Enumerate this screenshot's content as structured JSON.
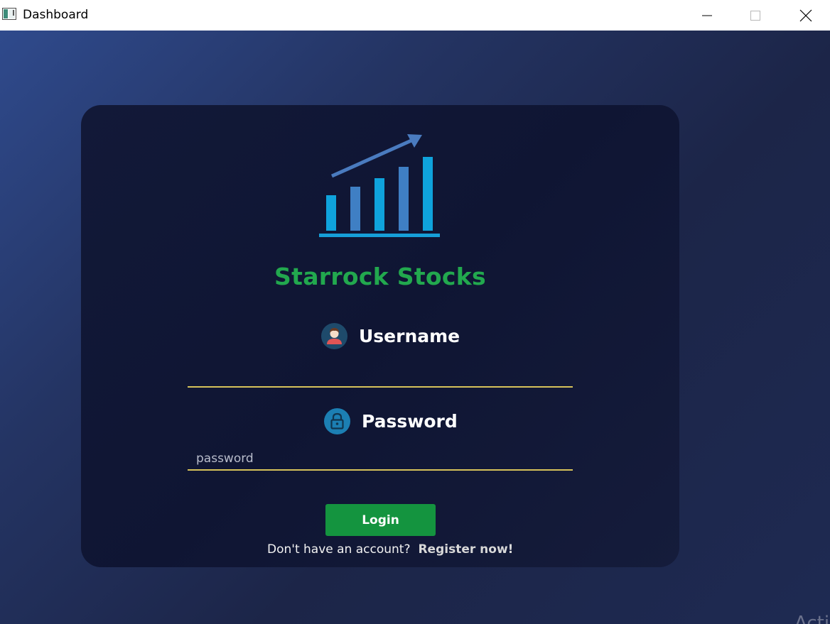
{
  "window": {
    "title": "Dashboard",
    "icon": "app-window-icon",
    "controls": [
      "minimize-icon",
      "maximize-icon",
      "close-icon"
    ]
  },
  "logo": {
    "icon": "bar-chart-growth-icon",
    "colors": {
      "bars_light": "#0fa3dc",
      "bars_dark": "#3f7fc4",
      "arrow": "#4a7bbf",
      "base": "#169fd8"
    }
  },
  "brand": {
    "name": "Starrock Stocks",
    "color": "#22a84e"
  },
  "form": {
    "username": {
      "label": "Username",
      "icon": "user-avatar-icon",
      "value": "",
      "placeholder": ""
    },
    "password": {
      "label": "Password",
      "icon": "lock-icon",
      "value": "",
      "placeholder": "password"
    },
    "login_label": "Login",
    "register_prompt": "Don't have an account?",
    "register_link": "Register now!"
  },
  "colors": {
    "card_bg": "#10163a",
    "input_underline": "#d6c25a",
    "button_bg": "#14943f"
  },
  "watermark": "Acti"
}
